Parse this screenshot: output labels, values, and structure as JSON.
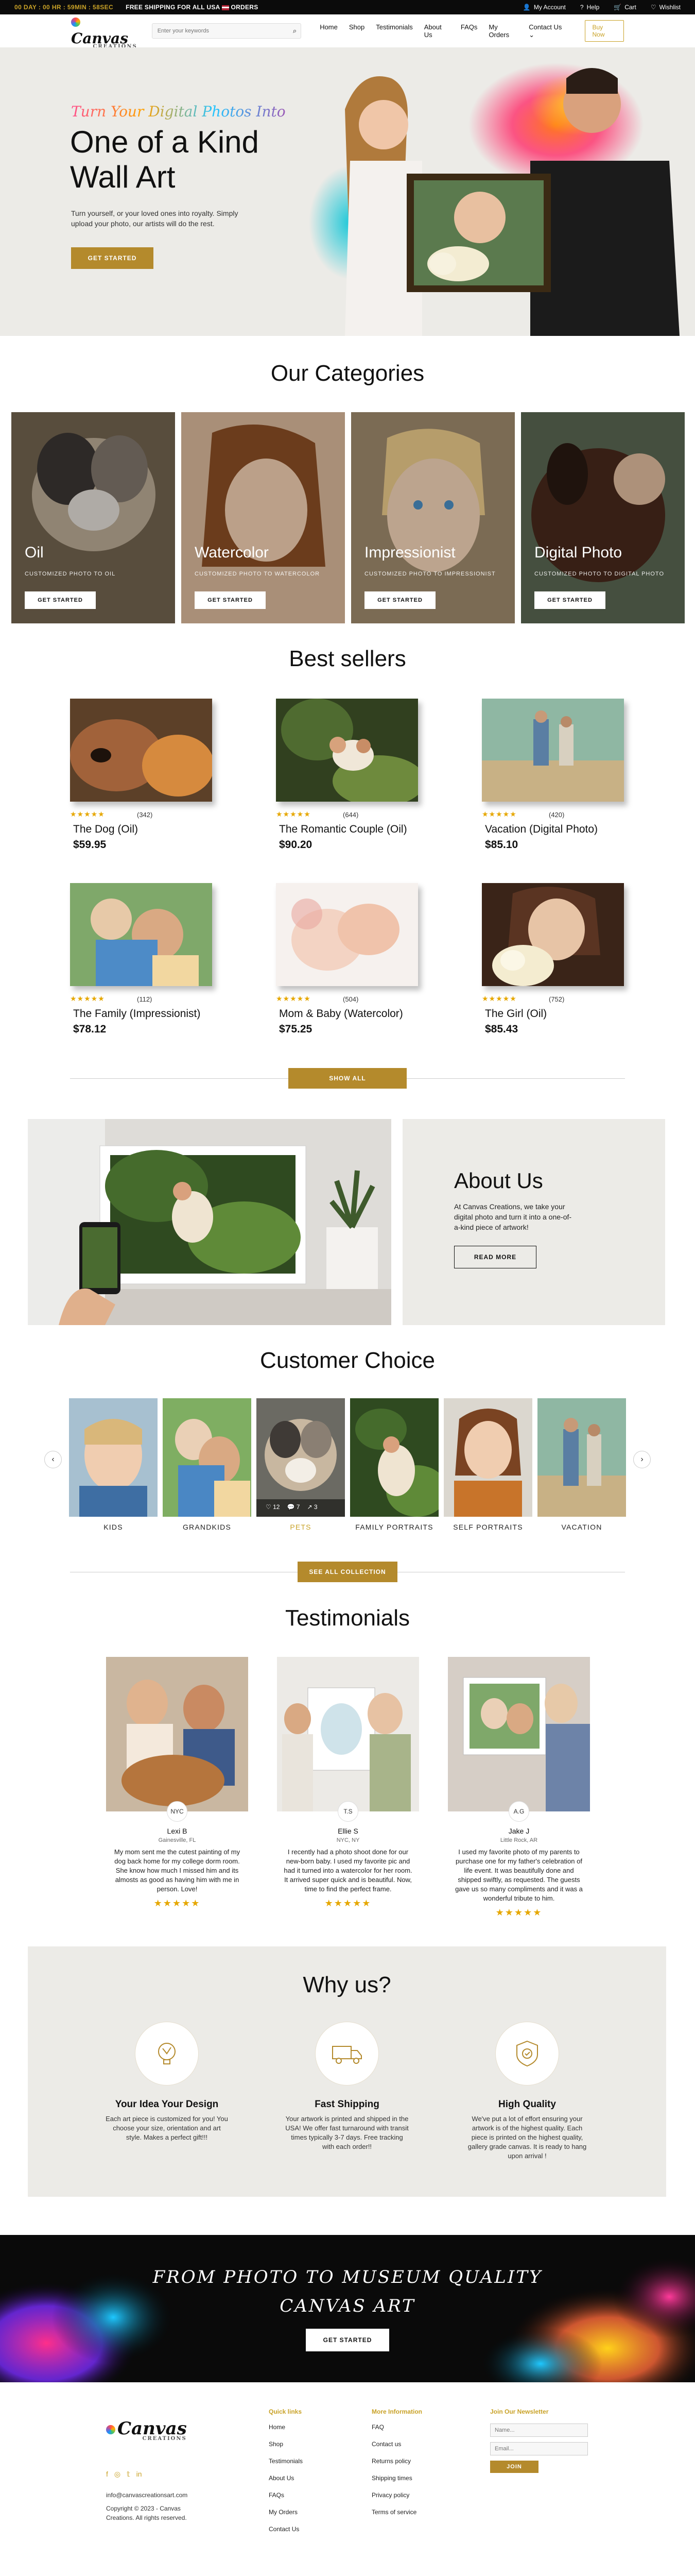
{
  "topbar": {
    "countdown": "00 DAY : 00 HR : 59MIN : 58SEC",
    "promo": "FREE SHIPPING FOR ALL USA",
    "promo_suffix": "ORDERS",
    "links": [
      "My Account",
      "Help",
      "Cart",
      "Wishlist"
    ]
  },
  "header": {
    "logo_text": "Canvas",
    "logo_sub": "CREATIONS",
    "search_placeholder": "Enter your keywords",
    "nav": [
      "Home",
      "Shop",
      "Testimonials",
      "About Us",
      "FAQs",
      "My Orders",
      "Contact Us"
    ],
    "buy_now": "Buy Now"
  },
  "hero": {
    "script": "Turn Your Digital Photos Into",
    "title": "One of a Kind Wall Art",
    "subtitle": "Turn yourself, or your loved ones into royalty. Simply upload your photo, our artists will do the rest.",
    "cta": "GET STARTED"
  },
  "categories": {
    "title": "Our Categories",
    "items": [
      {
        "title": "Oil",
        "desc": "CUSTOMIZED PHOTO TO OIL",
        "cta": "GET STARTED"
      },
      {
        "title": "Watercolor",
        "desc": "CUSTOMIZED PHOTO TO WATERCOLOR",
        "cta": "GET STARTED"
      },
      {
        "title": "Impressionist",
        "desc": "CUSTOMIZED PHOTO TO IMPRESSIONIST",
        "cta": "GET STARTED"
      },
      {
        "title": "Digital Photo",
        "desc": "CUSTOMIZED PHOTO TO DIGITAL PHOTO",
        "cta": "GET STARTED"
      }
    ]
  },
  "bestsellers": {
    "title": "Best sellers",
    "products": [
      {
        "name": "The Dog (Oil)",
        "price": "$59.95",
        "reviews": "(342)",
        "stars": "★★★★★"
      },
      {
        "name": "The Romantic Couple (Oil)",
        "price": "$90.20",
        "reviews": "(644)",
        "stars": "★★★★★"
      },
      {
        "name": "Vacation (Digital Photo)",
        "price": "$85.10",
        "reviews": "(420)",
        "stars": "★★★★★"
      },
      {
        "name": "The Family (Impressionist)",
        "price": "$78.12",
        "reviews": "(112)",
        "stars": "★★★★★"
      },
      {
        "name": "Mom & Baby (Watercolor)",
        "price": "$75.25",
        "reviews": "(504)",
        "stars": "★★★★★"
      },
      {
        "name": "The Girl (Oil)",
        "price": "$85.43",
        "reviews": "(752)",
        "stars": "★★★★★"
      }
    ],
    "show_all": "SHOW ALL"
  },
  "about": {
    "title": "About Us",
    "text": "At Canvas Creations, we take your digital photo and turn it into a one-of-a-kind piece of artwork!",
    "cta": "READ MORE"
  },
  "customer_choice": {
    "title": "Customer Choice",
    "items": [
      "KIDS",
      "GRANDKIDS",
      "PETS",
      "FAMILY PORTRAITS",
      "SELF PORTRAITS",
      "VACATION"
    ],
    "cta": "SEE ALL COLLECTION",
    "social": {
      "likes": "12",
      "comments": "7",
      "shares": "3"
    }
  },
  "testimonials": {
    "title": "Testimonials",
    "items": [
      {
        "badge": "NYC",
        "name": "Lexi B",
        "loc": "Gainesville, FL",
        "quote": "My mom sent me the cutest painting of my dog back home for my college dorm room. She know how much I missed him and its almosts as good as having him with me in person. Love!",
        "stars": "★★★★★"
      },
      {
        "badge": "T.S",
        "name": "Ellie S",
        "loc": "NYC, NY",
        "quote": "I recently had a photo shoot done for our new-born baby. I used my favorite pic and had it turned into a watercolor for her room. It arrived super quick and is beautiful. Now, time to find the perfect frame.",
        "stars": "★★★★★"
      },
      {
        "badge": "A.G",
        "name": "Jake J",
        "loc": "Little Rock, AR",
        "quote": "I used my favorite photo of my parents to purchase one for my father's celebration of life event. It was beautifully done and shipped swiftly, as requested. The guests gave us so many compliments and it was a wonderful tribute to him.",
        "stars": "★★★★★"
      }
    ]
  },
  "why": {
    "title": "Why us?",
    "items": [
      {
        "title": "Your Idea Your Design",
        "text": "Each art piece is customized for you! You choose your size, orientation and art style. Makes a perfect gift!!!"
      },
      {
        "title": "Fast Shipping",
        "text": "Your artwork is printed and shipped in the USA! We offer fast turnaround with transit times typically 3-7 days. Free tracking with each order!!"
      },
      {
        "title": "High Quality",
        "text": "We've put a lot of effort ensuring your artwork is of the highest quality. Each piece is printed on the highest quality, gallery grade canvas. It is ready to hang upon arrival !"
      }
    ]
  },
  "banner": {
    "line1": "FROM PHOTO TO MUSEUM QUALITY",
    "line2": "CANVAS ART",
    "cta": "GET STARTED"
  },
  "footer": {
    "email": "info@canvascreationsart.com",
    "copyright": "Copyright © 2023 - Canvas Creations. All rights reserved.",
    "quick_links_title": "Quick links",
    "quick_links": [
      "Home",
      "Shop",
      "Testimonials",
      "About Us",
      "FAQs",
      "My Orders",
      "Contact Us"
    ],
    "more_info_title": "More Information",
    "more_info": [
      "FAQ",
      "Contact us",
      "Returns policy",
      "Shipping times",
      "Privacy policy",
      "Terms of service"
    ],
    "newsletter_title": "Join Our Newsletter",
    "name_placeholder": "Name...",
    "email_placeholder": "Email...",
    "join": "JOIN"
  },
  "colors": {
    "gold": "#b48a2c",
    "accent_gold": "#c9a227",
    "beige": "#ecebe7",
    "dark": "#0b0b0b"
  }
}
